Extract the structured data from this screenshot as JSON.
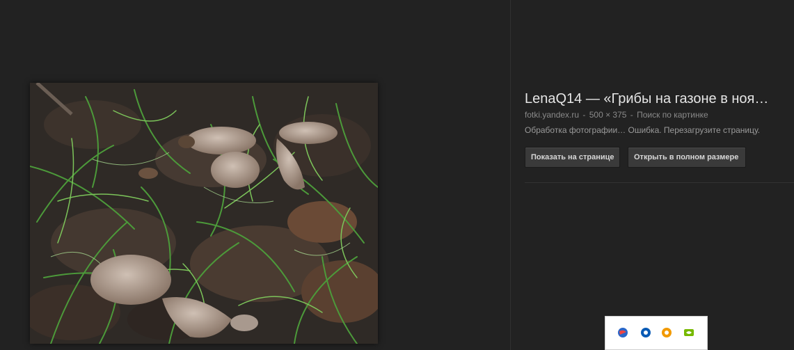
{
  "photo": {
    "description_hidden": ""
  },
  "info": {
    "title": "LenaQ14 — «Грибы на газоне в ноя…",
    "source": "fotki.yandex.ru",
    "size": "500 × 375",
    "search_link": "Поиск по картинке",
    "status": "Обработка фотографии… Ошибка. Перезагрузите страницу.",
    "show_on_page": "Показать на странице",
    "open_full_size": "Открыть в полном размере"
  },
  "tray": {
    "icons": [
      "globe-icon",
      "browser-icon",
      "avast-icon",
      "nvidia-icon"
    ],
    "colors": [
      "#2a66c8",
      "#0a5bb5",
      "#f29a00",
      "#76b900"
    ]
  }
}
